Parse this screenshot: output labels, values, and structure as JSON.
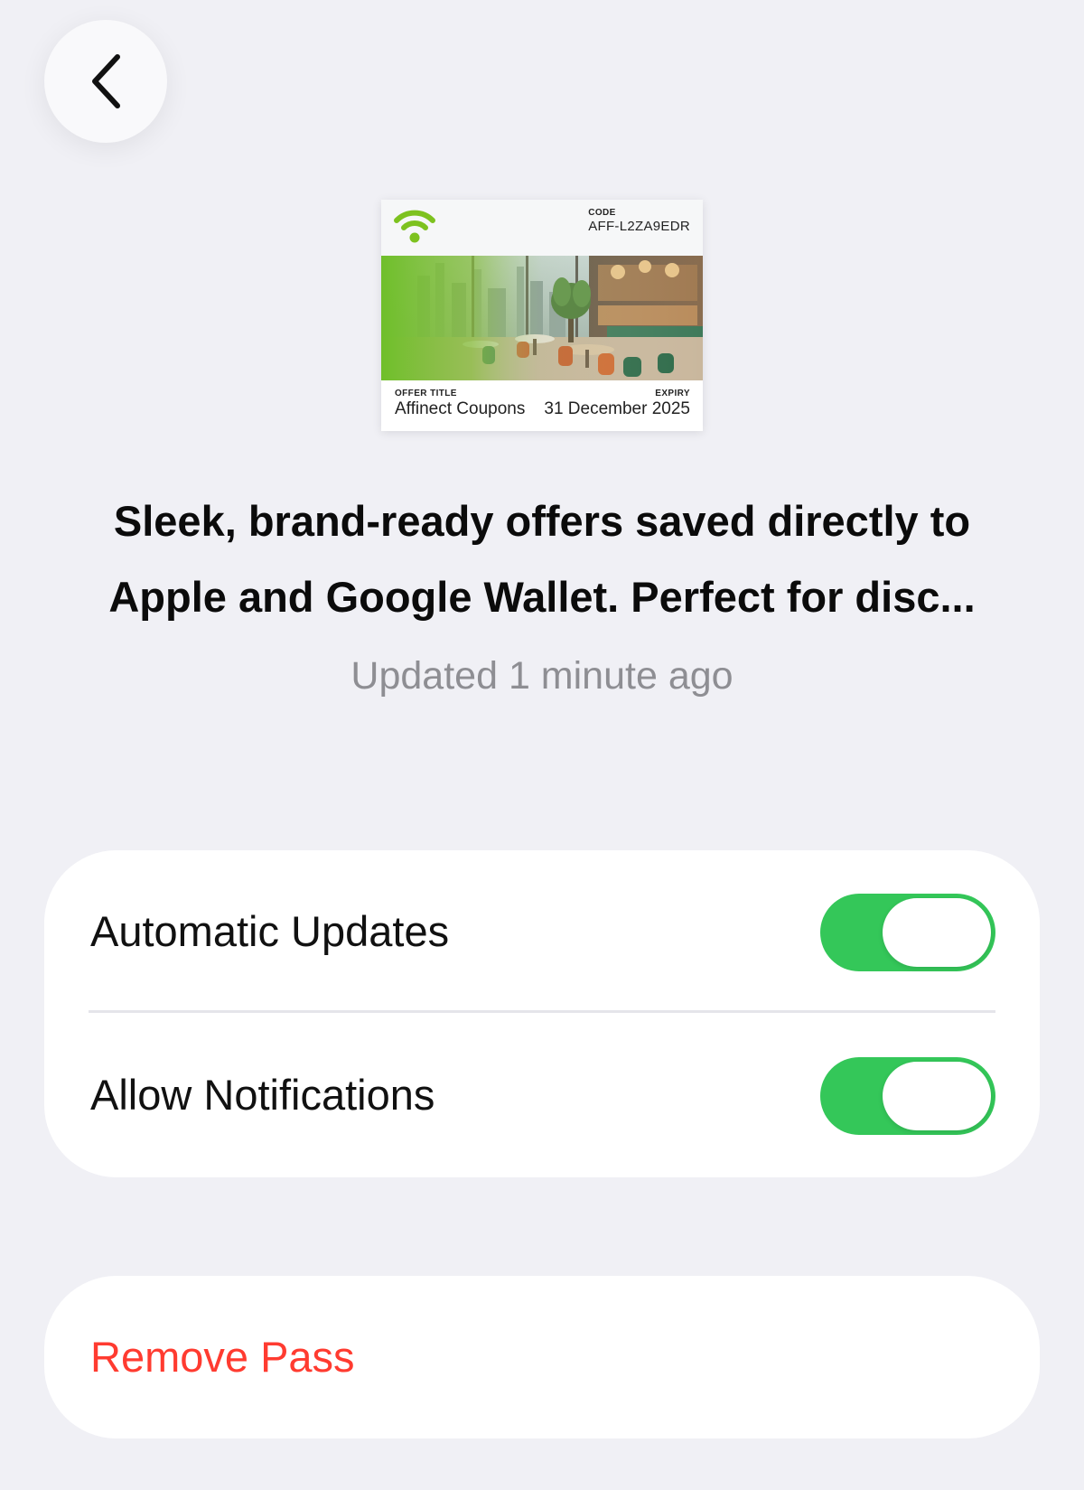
{
  "nav": {
    "back_icon": "chevron-left-icon"
  },
  "pass": {
    "logo_icon": "wifi-logo-icon",
    "code_label": "CODE",
    "code_value": "AFF-L2ZA9EDR",
    "offer_title_label": "OFFER TITLE",
    "offer_title_value": "Affinect Coupons",
    "expiry_label": "EXPIRY",
    "expiry_value": "31 December 2025",
    "accent_color": "#7dc21f"
  },
  "header": {
    "description": "Sleek, brand-ready offers saved directly to Apple and Google Wallet. Perfect for disc...",
    "updated": "Updated 1 minute ago"
  },
  "settings": {
    "automatic_updates": {
      "label": "Automatic Updates",
      "enabled": true
    },
    "allow_notifications": {
      "label": "Allow Notifications",
      "enabled": true
    },
    "toggle_on_color": "#34c759"
  },
  "actions": {
    "remove_pass_label": "Remove Pass",
    "remove_color": "#ff3b30"
  }
}
